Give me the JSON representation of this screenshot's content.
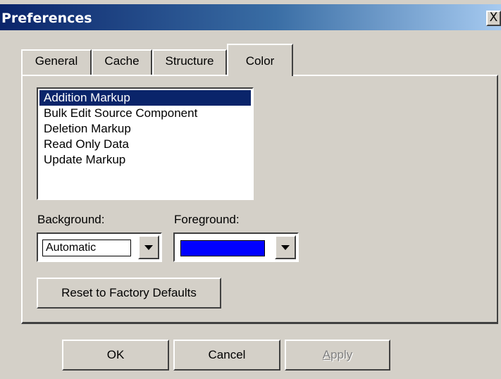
{
  "window": {
    "title": "Preferences",
    "close_glyph": "X"
  },
  "tabs": [
    {
      "label": "General",
      "active": false
    },
    {
      "label": "Cache",
      "active": false
    },
    {
      "label": "Structure",
      "active": false
    },
    {
      "label": "Color",
      "active": true
    }
  ],
  "markup_list": {
    "items": [
      "Addition Markup",
      "Bulk Edit Source Component",
      "Deletion Markup",
      "Read Only Data",
      "Update Markup"
    ],
    "selected": "Addition Markup"
  },
  "background": {
    "label": "Background:",
    "value": "Automatic"
  },
  "foreground": {
    "label": "Foreground:",
    "value_color": "#0000ff"
  },
  "reset_button": {
    "label": "Reset to Factory Defaults"
  },
  "footer": {
    "ok_label": "OK",
    "cancel_label": "Cancel",
    "apply_label": "Apply",
    "apply_mnemonic": "A",
    "apply_rest": "pply",
    "apply_enabled": false
  },
  "colors": {
    "titlebar_start": "#0a246a",
    "selection": "#0a246a",
    "dialog_face": "#d4d0c8"
  },
  "icons": {
    "close": "close-icon",
    "dropdown": "chevron-down-icon"
  }
}
